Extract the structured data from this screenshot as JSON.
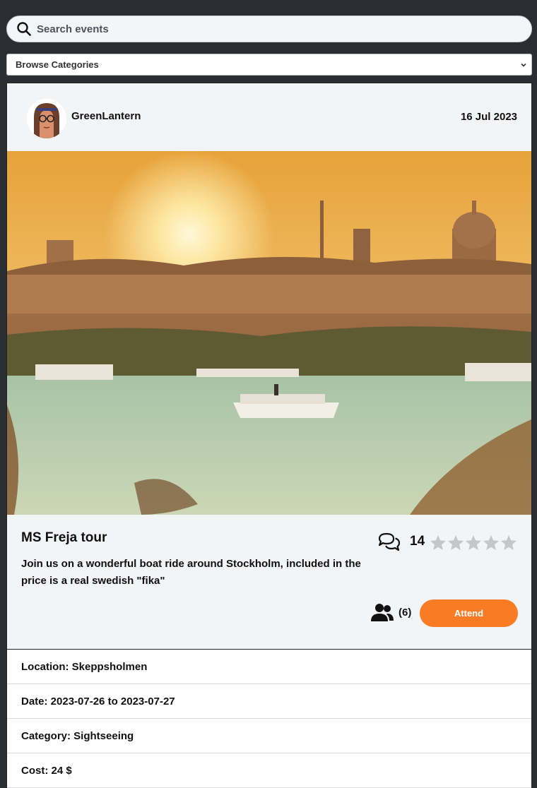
{
  "search": {
    "placeholder": "Search events",
    "icon": "search-icon"
  },
  "category_select": {
    "selected": "Browse Categories"
  },
  "event": {
    "username": "GreenLantern",
    "posted_date": "16 Jul 2023",
    "title": "MS Freja tour",
    "description": "Join us on a wonderful boat ride around Stockholm, included in the price is a real swedish \"fika\"",
    "comment_count": "14",
    "rating": 0,
    "rating_max": 5,
    "attendee_count": "(6)",
    "attend_label": "Attend",
    "details": {
      "location": "Location: Skeppsholmen",
      "date": "Date: 2023-07-26 to 2023-07-27",
      "category": "Category: Sightseeing",
      "cost": "Cost: 24 $"
    }
  },
  "colors": {
    "accent": "#f97c24",
    "background": "#2a2d31",
    "card": "#f3f4f6",
    "star_empty": "#c4c6c9"
  }
}
